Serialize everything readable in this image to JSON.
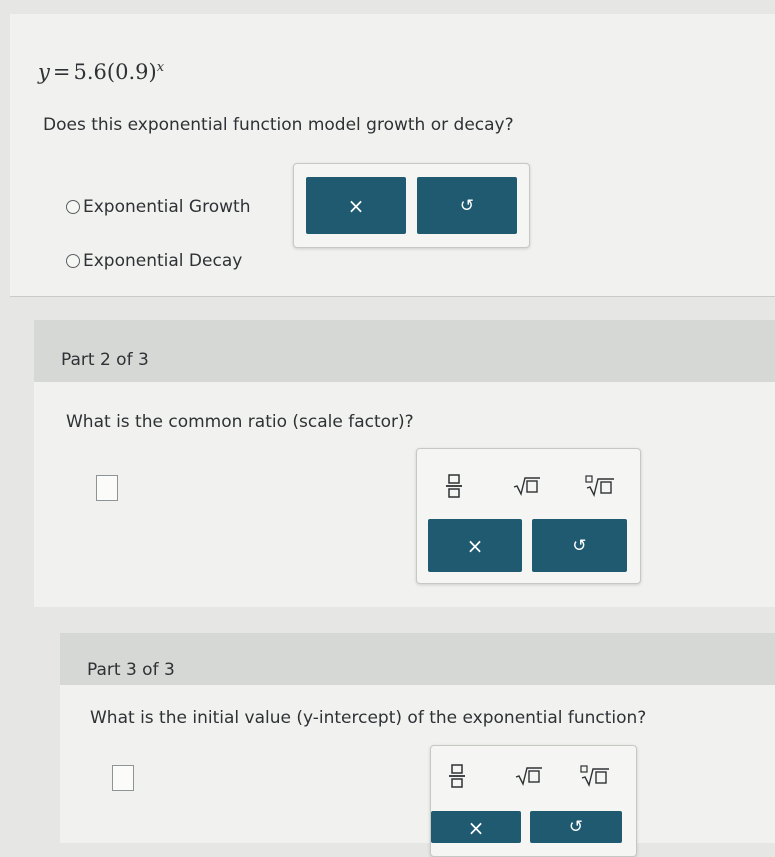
{
  "part1": {
    "equation": {
      "lhs": "y",
      "eq": "=",
      "coef": "5.6",
      "base": "(0.9)",
      "exponent": "x"
    },
    "question": "Does this exponential function model growth or decay?",
    "options": [
      "Exponential Growth",
      "Exponential Decay"
    ],
    "clear_symbol": "×",
    "undo_symbol": "↺"
  },
  "part2": {
    "header": "Part 2 of 3",
    "question": "What is the common ratio (scale factor)?",
    "clear_symbol": "×",
    "undo_symbol": "↺"
  },
  "part3": {
    "header": "Part 3 of 3",
    "question": "What is the initial value (y-intercept) of the exponential function?",
    "clear_symbol": "×",
    "undo_symbol": "↺"
  },
  "icons": {
    "fraction": "fraction-icon",
    "sqrt": "square-root-icon",
    "nthroot": "nth-root-icon"
  },
  "colors": {
    "button": "#1f5a70",
    "panel": "#f1f2ef",
    "band": "#d6d8d5",
    "text": "#2e3135"
  }
}
